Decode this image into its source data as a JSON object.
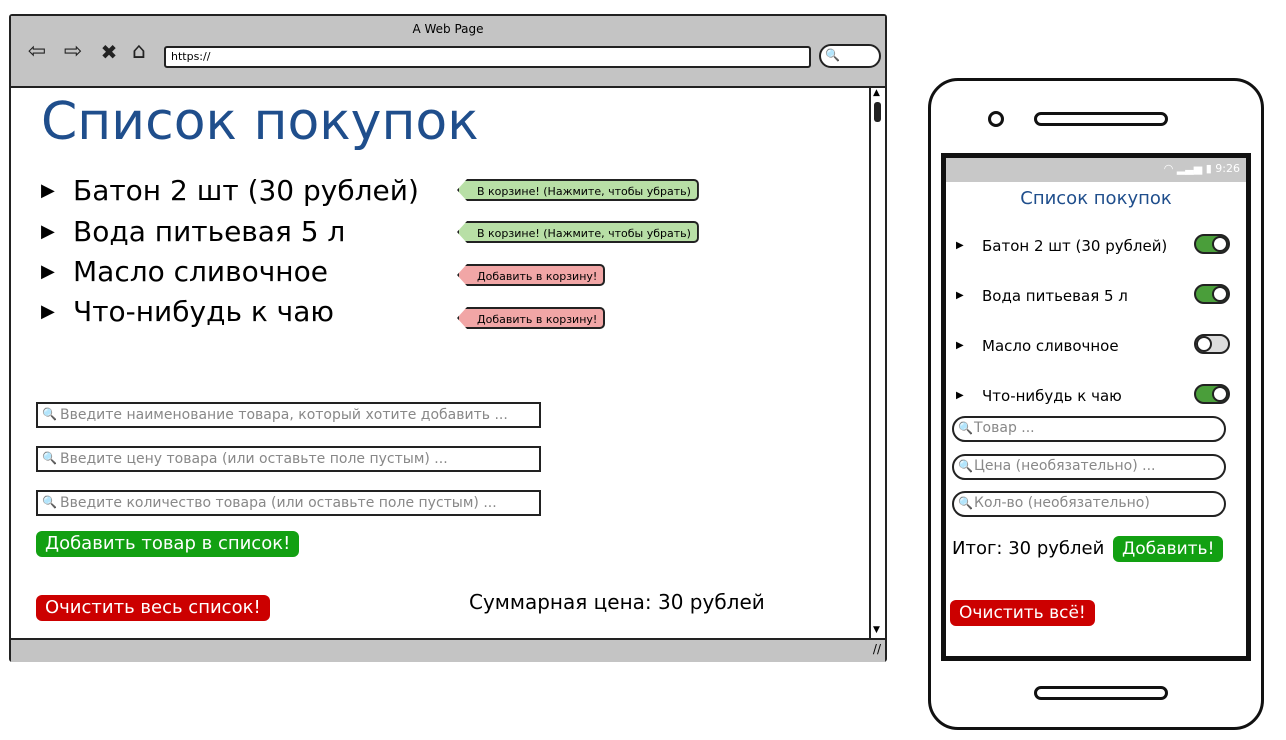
{
  "browser": {
    "title": "A Web Page",
    "url": "https://",
    "nav": {
      "back": "⇦",
      "forward": "⇨",
      "stop": "✖",
      "home": "⌂"
    },
    "icons": {
      "search": "🔍",
      "scroll_up": "▲",
      "scroll_down": "▼",
      "resize": "//"
    }
  },
  "desktop": {
    "title": "Список покупок",
    "items": [
      {
        "label": "Батон 2 шт (30 рублей)",
        "status": "В корзине! (Нажмите, чтобы убрать)",
        "in_cart": true
      },
      {
        "label": "Вода питьевая 5 л",
        "status": "В корзине! (Нажмите, чтобы убрать)",
        "in_cart": true
      },
      {
        "label": "Масло сливочное",
        "status": "Добавить в корзину!",
        "in_cart": false
      },
      {
        "label": "Что-нибудь к чаю",
        "status": "Добавить в корзину!",
        "in_cart": false
      }
    ],
    "inputs": {
      "name_placeholder": "Введите наименование товара, который хотите добавить ...",
      "price_placeholder": "Введите цену товара (или оставьте поле пустым) ...",
      "qty_placeholder": "Введите количество товара (или оставьте поле пустым) ..."
    },
    "add_button": "Добавить товар в список!",
    "clear_button": "Очистить весь список!",
    "total": "Суммарная цена: 30 рублей"
  },
  "mobile": {
    "status_time": "9:26",
    "title": "Список покупок",
    "items": [
      {
        "label": "Батон 2 шт (30 рублей)",
        "on": true
      },
      {
        "label": "Вода питьевая 5 л",
        "on": true
      },
      {
        "label": "Масло сливочное",
        "on": false
      },
      {
        "label": "Что-нибудь к чаю",
        "on": true
      }
    ],
    "inputs": {
      "name_placeholder": "Товар ...",
      "price_placeholder": "Цена (необязательно) ...",
      "qty_placeholder": "Кол-во (необязательно)"
    },
    "total": "Итог: 30 рублей",
    "add_button": "Добавить!",
    "clear_button": "Очистить всё!"
  },
  "colors": {
    "title_blue": "#1f4e8c",
    "button_green": "#12a012",
    "button_red": "#cc0000",
    "tag_green": "#b8dfa6",
    "tag_red": "#f1a6a6",
    "toggle_on": "#4a9e3a"
  }
}
